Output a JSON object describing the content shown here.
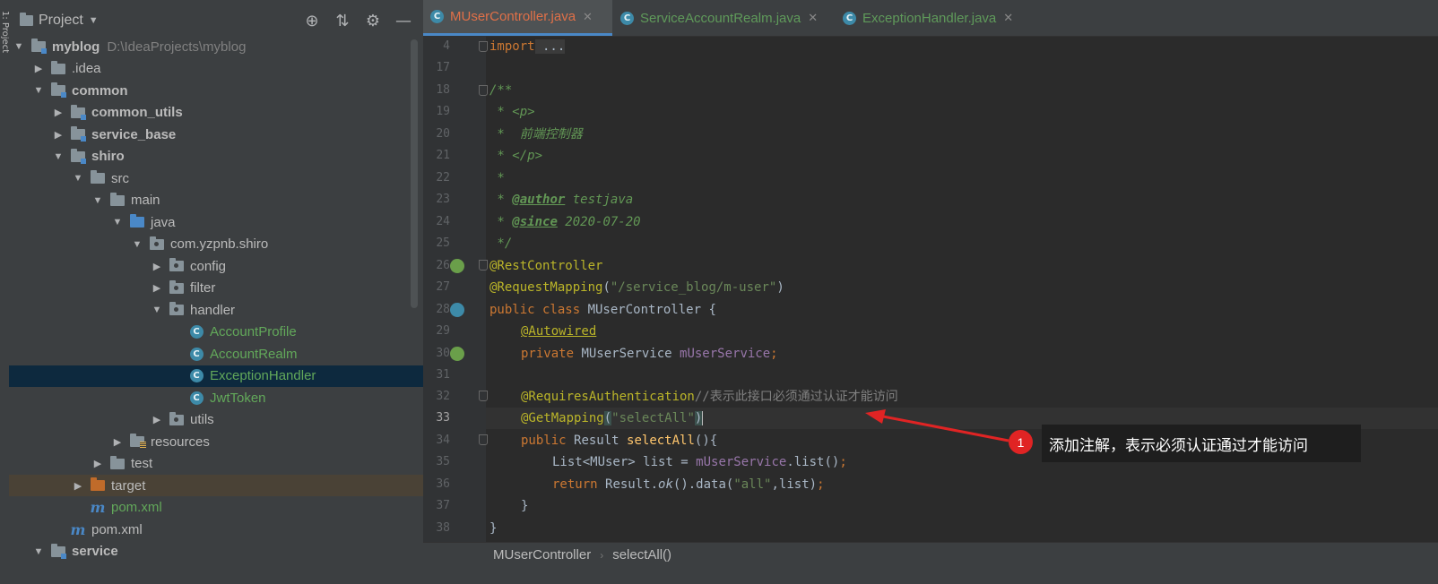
{
  "side_strip": {
    "label": "1: Project"
  },
  "project_panel": {
    "title": "Project",
    "tree": [
      {
        "label": "myblog",
        "path": "D:\\IdeaProjects\\myblog",
        "bold": true,
        "type": "module",
        "indent": 0,
        "arrow": "open"
      },
      {
        "label": ".idea",
        "type": "folder",
        "indent": 1,
        "arrow": "closed"
      },
      {
        "label": "common",
        "bold": true,
        "type": "module",
        "indent": 1,
        "arrow": "open"
      },
      {
        "label": "common_utils",
        "bold": true,
        "type": "module",
        "indent": 2,
        "arrow": "closed"
      },
      {
        "label": "service_base",
        "bold": true,
        "type": "module",
        "indent": 2,
        "arrow": "closed"
      },
      {
        "label": "shiro",
        "bold": true,
        "type": "module",
        "indent": 2,
        "arrow": "open"
      },
      {
        "label": "src",
        "type": "folder",
        "indent": 3,
        "arrow": "open"
      },
      {
        "label": "main",
        "type": "folder",
        "indent": 4,
        "arrow": "open"
      },
      {
        "label": "java",
        "type": "folder-blue",
        "indent": 5,
        "arrow": "open"
      },
      {
        "label": "com.yzpnb.shiro",
        "type": "package",
        "indent": 6,
        "arrow": "open"
      },
      {
        "label": "config",
        "type": "package",
        "indent": 7,
        "arrow": "closed"
      },
      {
        "label": "filter",
        "type": "package",
        "indent": 7,
        "arrow": "closed"
      },
      {
        "label": "handler",
        "type": "package",
        "indent": 7,
        "arrow": "open"
      },
      {
        "label": "AccountProfile",
        "type": "class",
        "indent": 8,
        "arrow": ""
      },
      {
        "label": "AccountRealm",
        "type": "class",
        "indent": 8,
        "arrow": ""
      },
      {
        "label": "ExceptionHandler",
        "type": "class",
        "indent": 8,
        "arrow": "",
        "selected": true
      },
      {
        "label": "JwtToken",
        "type": "class",
        "indent": 8,
        "arrow": ""
      },
      {
        "label": "utils",
        "type": "package",
        "indent": 7,
        "arrow": "closed"
      },
      {
        "label": "resources",
        "type": "resources",
        "indent": 5,
        "arrow": "closed"
      },
      {
        "label": "test",
        "type": "folder",
        "indent": 4,
        "arrow": "closed"
      },
      {
        "label": "target",
        "type": "folder-orange",
        "indent": 3,
        "arrow": "closed",
        "excluded": true
      },
      {
        "label": "pom.xml",
        "type": "maven",
        "indent": 3,
        "arrow": "",
        "green": true
      },
      {
        "label": "pom.xml",
        "type": "maven",
        "indent": 2,
        "arrow": "",
        "green": false
      },
      {
        "label": "service",
        "bold": true,
        "type": "module",
        "indent": 1,
        "arrow": "open"
      }
    ]
  },
  "tabs": [
    {
      "label": "MUserController.java",
      "active": true
    },
    {
      "label": "ServiceAccountRealm.java",
      "active": false
    },
    {
      "label": "ExceptionHandler.java",
      "active": false
    }
  ],
  "line_numbers": [
    "4",
    "17",
    "18",
    "19",
    "20",
    "21",
    "22",
    "23",
    "24",
    "25",
    "26",
    "27",
    "28",
    "29",
    "30",
    "31",
    "32",
    "33",
    "34",
    "35",
    "36",
    "37",
    "38"
  ],
  "code": {
    "l4": [
      "import",
      " ..."
    ],
    "l18": "/**",
    "l19": [
      " * ",
      "<p>"
    ],
    "l20": " *  前端控制器",
    "l21": [
      " * ",
      "</p>"
    ],
    "l22": " *",
    "l23": [
      " * ",
      "@author",
      " testjava"
    ],
    "l24": [
      " * ",
      "@since",
      " 2020-07-20"
    ],
    "l25": " */",
    "l26": "@RestController",
    "l27": [
      "@RequestMapping",
      "(",
      "\"/service_blog/m-user\"",
      ")"
    ],
    "l28": [
      "public class ",
      "MUserController {"
    ],
    "l29": "@Autowired",
    "l30": [
      "private ",
      "MUserService ",
      "mUserService",
      ";"
    ],
    "l32": [
      "@RequiresAuthentication",
      "//表示此接口必须通过认证才能访问"
    ],
    "l33": [
      "@GetMapping",
      "(",
      "\"selectAll\"",
      ")"
    ],
    "l34": [
      "public ",
      "Result ",
      "selectAll",
      "(){"
    ],
    "l35": [
      "List<MUser> list = ",
      "mUserService",
      ".list()",
      ";"
    ],
    "l36": [
      "return ",
      "Result.",
      "ok",
      "().data(",
      "\"all\"",
      ",list)",
      ";"
    ],
    "l37": "}",
    "l38": "}"
  },
  "breadcrumb": {
    "class": "MUserController",
    "method": "selectAll()"
  },
  "callout": {
    "badge": "1",
    "text": "添加注解，表示必须认证通过才能访问"
  },
  "colors": {
    "keyword": "#cc7832",
    "annotation": "#bbb529",
    "string": "#6a8759",
    "comment": "#629755",
    "field": "#9876aa",
    "method": "#ffc66d",
    "badge": "#e02424"
  }
}
